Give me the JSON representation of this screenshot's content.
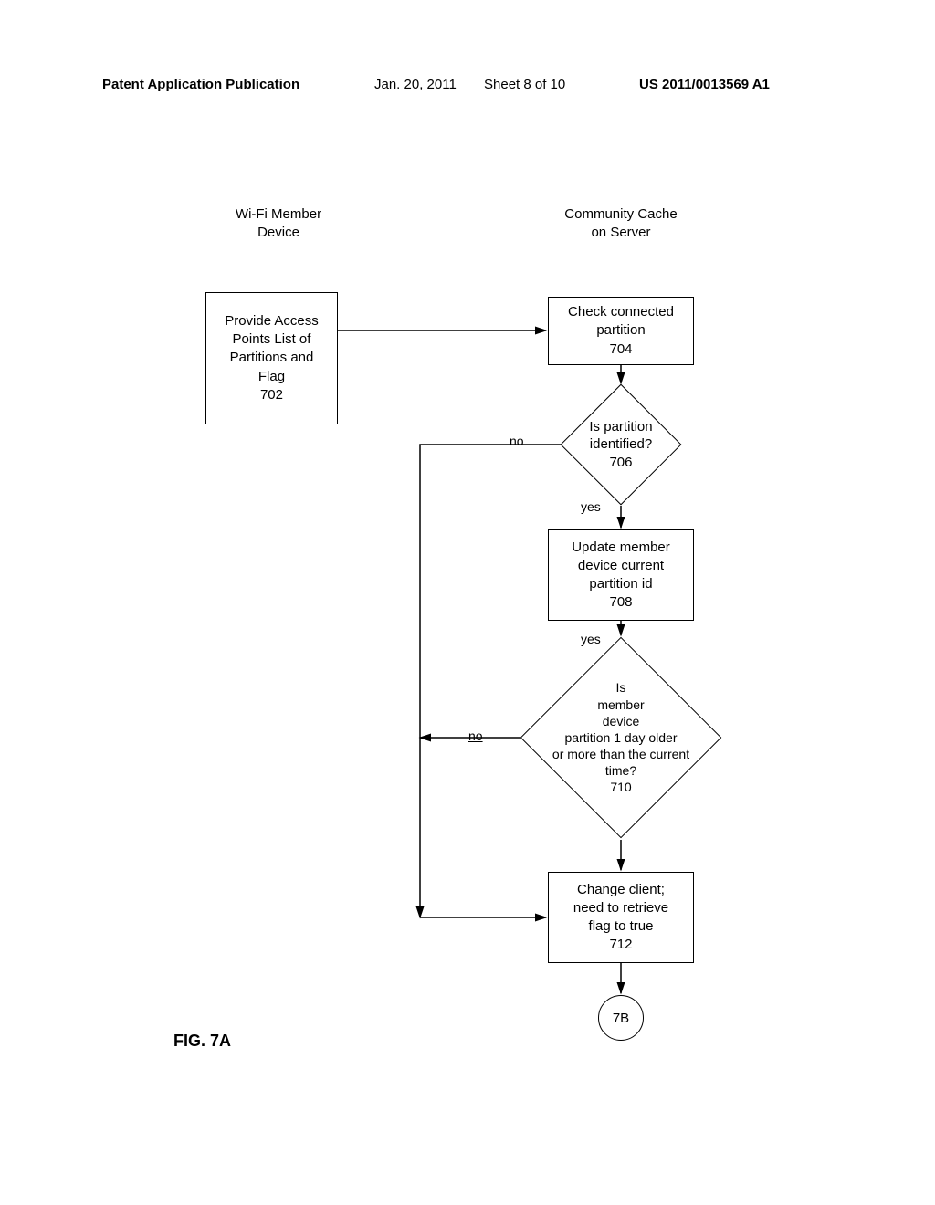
{
  "header": {
    "pub_type": "Patent Application Publication",
    "date": "Jan. 20, 2011",
    "sheet": "Sheet 8 of 10",
    "pub_number": "US 2011/0013569 A1"
  },
  "columns": {
    "left_label": "Wi-Fi Member\nDevice",
    "right_label": "Community Cache\non Server"
  },
  "nodes": {
    "n702": "Provide Access\nPoints List of\nPartitions and\nFlag\n702",
    "n704": "Check connected\npartition\n704",
    "n706": "Is partition\nidentified?\n706",
    "n708": "Update member\ndevice current\npartition id\n708",
    "n710": "Is\nmember\ndevice\npartition 1 day older\nor more than the current\ntime?\n710",
    "n712": "Change client;\nneed to retrieve\nflag to true\n712",
    "n7b": "7B"
  },
  "edges": {
    "no": "no",
    "yes": "yes"
  },
  "figure_label": "FIG.  7A"
}
